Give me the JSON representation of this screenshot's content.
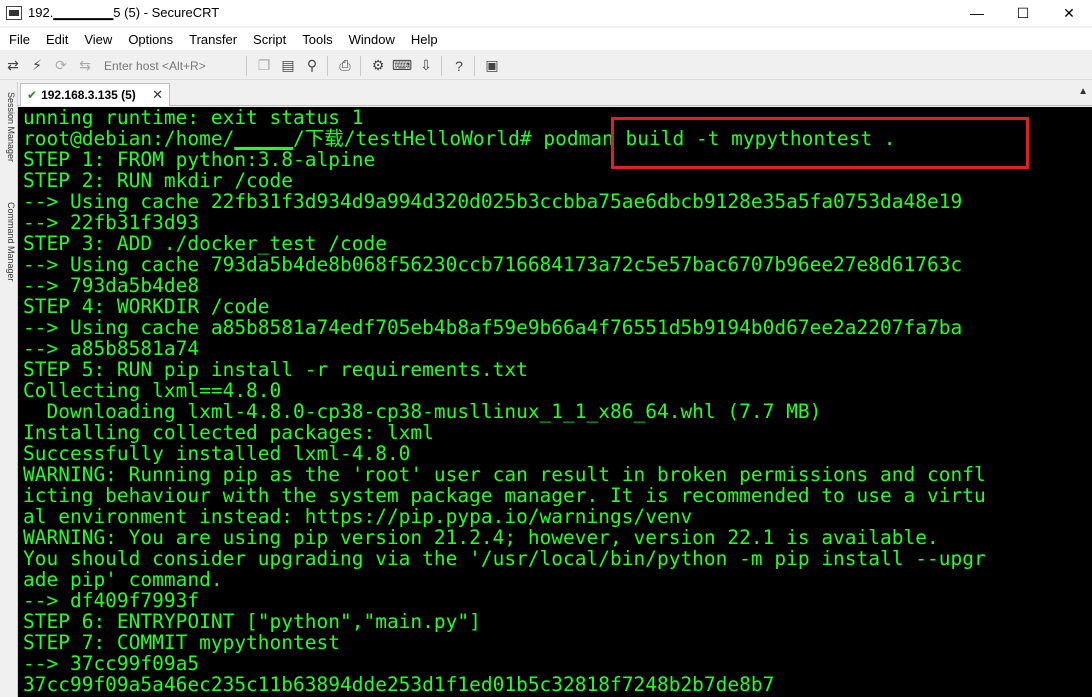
{
  "window": {
    "title": "192.▁▁▁▁▁▁5 (5) - SecureCRT",
    "minimize_glyph": "—",
    "maximize_glyph": "☐",
    "close_glyph": "✕"
  },
  "menubar": {
    "items": [
      "File",
      "Edit",
      "View",
      "Options",
      "Transfer",
      "Script",
      "Tools",
      "Window",
      "Help"
    ]
  },
  "toolbar": {
    "host_placeholder": "Enter host <Alt+R>",
    "icons": [
      "connect-icon",
      "lightning-icon",
      "reconnect-icon",
      "disconnect-icon",
      "copy-icon",
      "paste-icon",
      "find-icon",
      "print-icon",
      "settings-icon",
      "keymap-icon",
      "sftp-icon",
      "help-icon",
      "image-icon"
    ]
  },
  "sidepanel": {
    "labels": [
      "Session Manager",
      "Command Manager"
    ]
  },
  "tab": {
    "label": "192.168.3.135 (5)",
    "close_glyph": "✕",
    "scroll_glyph": "▲"
  },
  "terminal": {
    "lines": [
      "unning runtime: exit status 1",
      "root@debian:/home/▁▁▁▁▁/下载/testHelloWorld# podman build -t mypythontest .",
      "STEP 1: FROM python:3.8-alpine",
      "STEP 2: RUN mkdir /code",
      "--> Using cache 22fb31f3d934d9a994d320d025b3ccbba75ae6dbcb9128e35a5fa0753da48e19",
      "--> 22fb31f3d93",
      "STEP 3: ADD ./docker_test /code",
      "--> Using cache 793da5b4de8b068f56230ccb716684173a72c5e57bac6707b96ee27e8d61763c",
      "--> 793da5b4de8",
      "STEP 4: WORKDIR /code",
      "--> Using cache a85b8581a74edf705eb4b8af59e9b66a4f76551d5b9194b0d67ee2a2207fa7ba",
      "--> a85b8581a74",
      "STEP 5: RUN pip install -r requirements.txt",
      "Collecting lxml==4.8.0",
      "  Downloading lxml-4.8.0-cp38-cp38-musllinux_1_1_x86_64.whl (7.7 MB)",
      "Installing collected packages: lxml",
      "Successfully installed lxml-4.8.0",
      "WARNING: Running pip as the 'root' user can result in broken permissions and confl",
      "icting behaviour with the system package manager. It is recommended to use a virtu",
      "al environment instead: https://pip.pypa.io/warnings/venv",
      "WARNING: You are using pip version 21.2.4; however, version 22.1 is available.",
      "You should consider upgrading via the '/usr/local/bin/python -m pip install --upgr",
      "ade pip' command.",
      "--> df409f7993f",
      "STEP 6: ENTRYPOINT [\"python\",\"main.py\"]",
      "STEP 7: COMMIT mypythontest",
      "--> 37cc99f09a5",
      "37cc99f09a5a46ec235c11b63894dde253d1f1ed01b5c32818f7248b2b7de8b7"
    ],
    "text_color": "#22ff22",
    "background": "#000000",
    "highlight_color": "#e02020"
  }
}
